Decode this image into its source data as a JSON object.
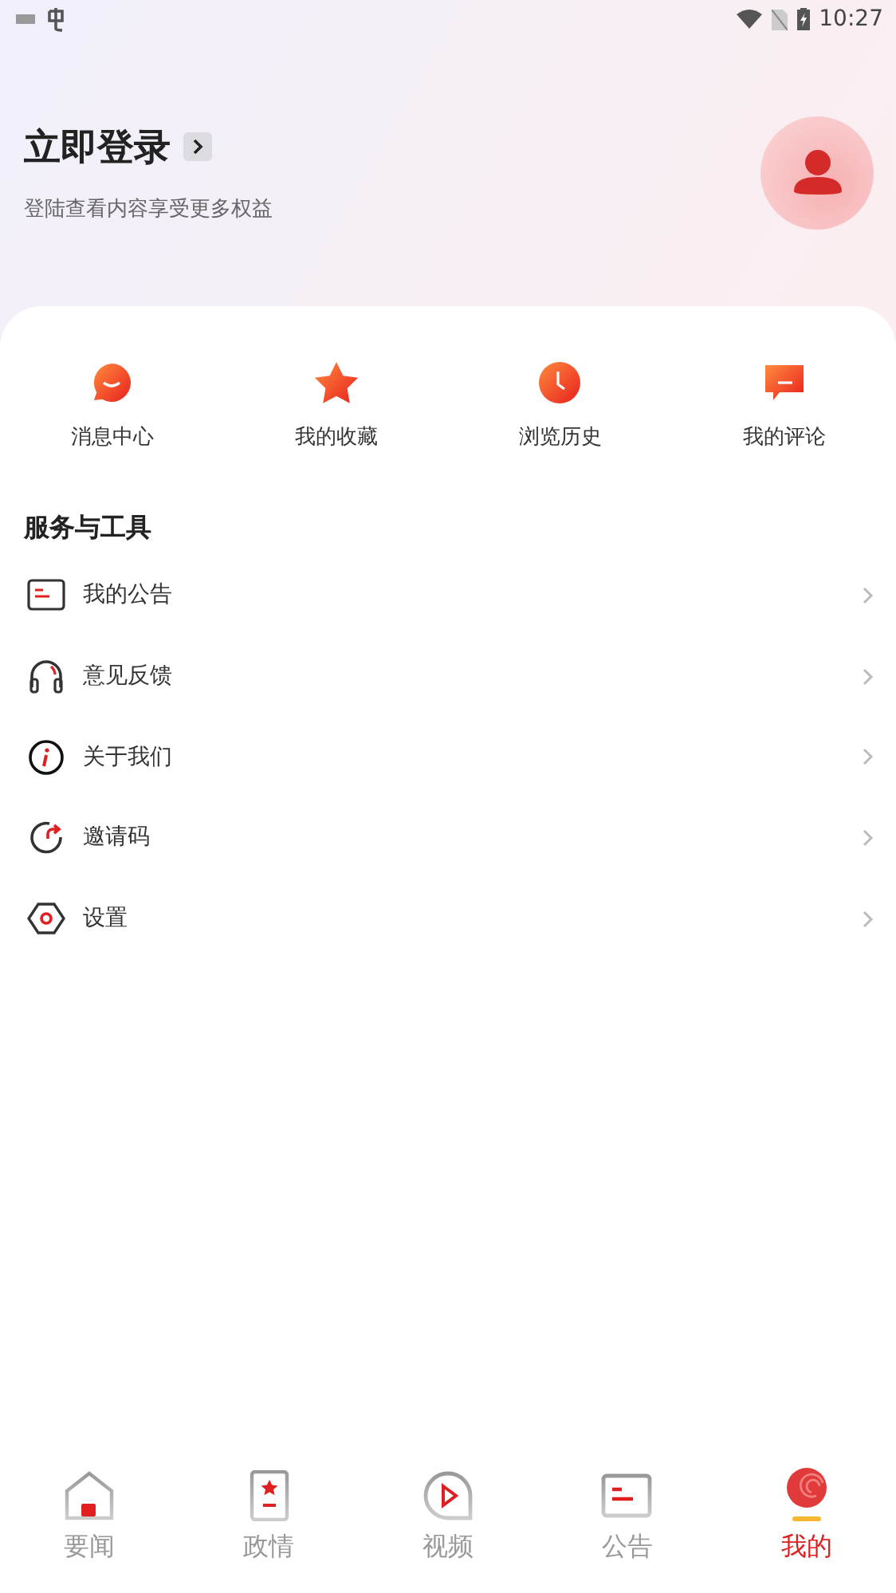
{
  "status_bar": {
    "time": "10:27"
  },
  "login": {
    "title": "立即登录",
    "subtitle": "登陆查看内容享受更多权益"
  },
  "shortcuts": [
    {
      "label": "消息中心"
    },
    {
      "label": "我的收藏"
    },
    {
      "label": "浏览历史"
    },
    {
      "label": "我的评论"
    }
  ],
  "services": {
    "title": "服务与工具",
    "items": [
      {
        "label": "我的公告"
      },
      {
        "label": "意见反馈"
      },
      {
        "label": "关于我们"
      },
      {
        "label": "邀请码"
      },
      {
        "label": "设置"
      }
    ]
  },
  "bottom_nav": [
    {
      "label": "要闻",
      "selected": false
    },
    {
      "label": "政情",
      "selected": false
    },
    {
      "label": "视频",
      "selected": false
    },
    {
      "label": "公告",
      "selected": false
    },
    {
      "label": "我的",
      "selected": true
    }
  ]
}
